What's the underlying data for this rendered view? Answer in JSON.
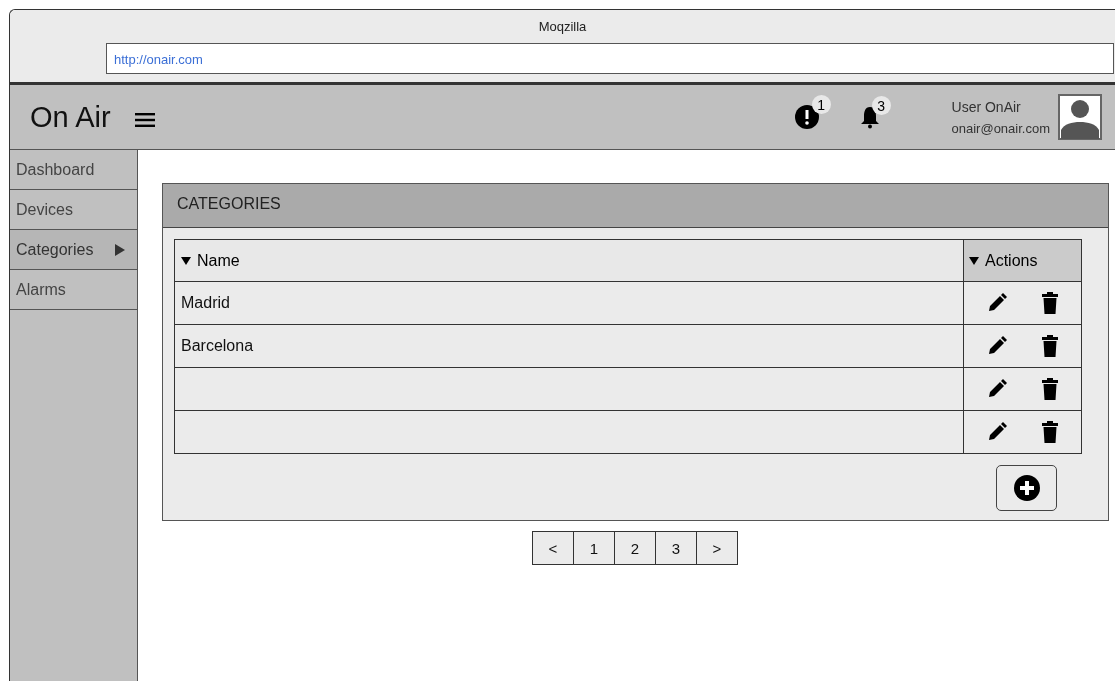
{
  "window": {
    "title": "Moqzilla",
    "url": "http://onair.com"
  },
  "header": {
    "brand": "On Air",
    "alerts_badge": "1",
    "notifications_badge": "3",
    "user_name": "User OnAir",
    "user_email": "onair@onair.com"
  },
  "sidebar": {
    "items": [
      {
        "label": "Dashboard",
        "selected": false
      },
      {
        "label": "Devices",
        "selected": false
      },
      {
        "label": "Categories",
        "selected": true
      },
      {
        "label": "Alarms",
        "selected": false
      }
    ]
  },
  "panel": {
    "title": "CATEGORIES",
    "table": {
      "columns": [
        "Name",
        "Actions"
      ],
      "rows": [
        {
          "name": "Madrid"
        },
        {
          "name": "Barcelona"
        },
        {
          "name": ""
        },
        {
          "name": ""
        }
      ]
    }
  },
  "pagination": [
    "<",
    "1",
    "2",
    "3",
    ">"
  ]
}
